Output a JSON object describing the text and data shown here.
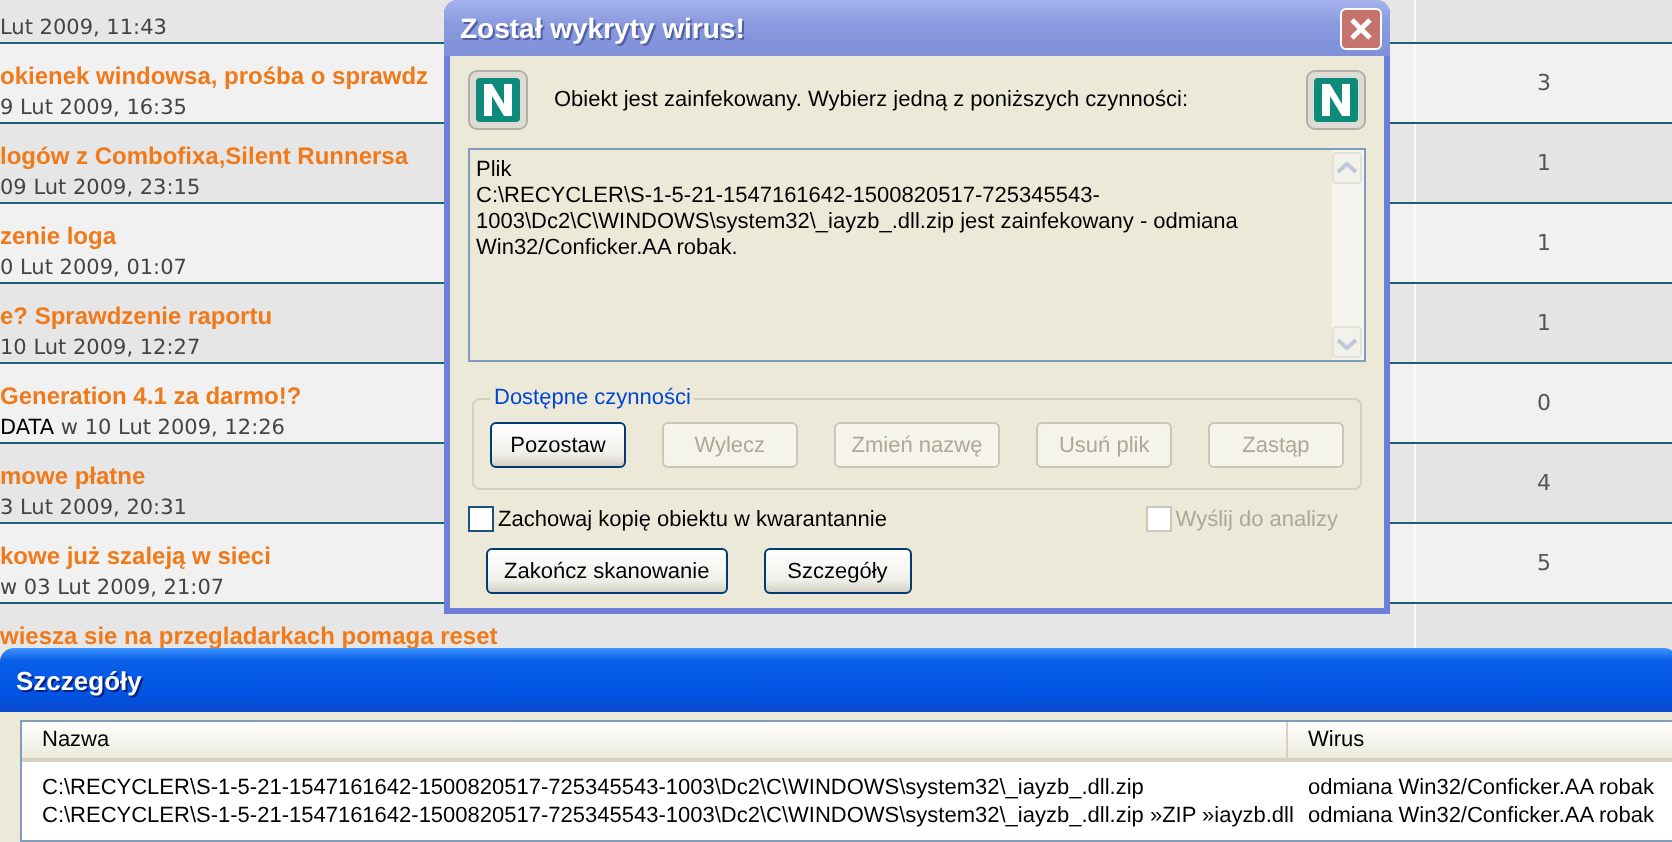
{
  "forum": {
    "topics": [
      {
        "date": "Lut 2009, 11:43"
      },
      {
        "title": "okienek windowsa, prośba o sprawdz",
        "date": "9 Lut 2009, 16:35",
        "replies": "3"
      },
      {
        "title": "logów z Combofixa,Silent Runnersa",
        "date": "09 Lut 2009, 23:15",
        "replies": "1"
      },
      {
        "title": "zenie loga",
        "date": "0 Lut 2009, 01:07",
        "replies": "1"
      },
      {
        "title": "e? Sprawdzenie raportu",
        "date": "10 Lut 2009, 12:27",
        "replies": "1"
      },
      {
        "title": "Generation 4.1 za darmo!?",
        "author": "DATA",
        "date": "w 10 Lut 2009, 12:26",
        "replies": "0"
      },
      {
        "title": "mowe płatne",
        "date": "3 Lut 2009, 20:31",
        "replies": "4"
      },
      {
        "title": "kowe już szaleją w sieci",
        "date": "w 03 Lut 2009, 21:07",
        "replies": "5"
      },
      {
        "title": "wiesza sie na przegladarkach pomaga reset"
      }
    ]
  },
  "dialog": {
    "title": "Został wykryty wirus!",
    "message": "Obiekt jest zainfekowany. Wybierz jedną z poniższych czynności:",
    "details": [
      "Plik",
      "C:\\RECYCLER\\S-1-5-21-1547161642-1500820517-725345543-1003\\Dc2\\C\\WINDOWS\\system32\\_iayzb_.dll.zip jest zainfekowany - odmiana Win32/Conficker.AA robak."
    ],
    "actions": {
      "label": "Dostępne czynności",
      "buttons": [
        {
          "label": "Pozostaw",
          "disabled": false
        },
        {
          "label": "Wylecz",
          "disabled": true
        },
        {
          "label": "Zmień nazwę",
          "disabled": true
        },
        {
          "label": "Usuń plik",
          "disabled": true
        },
        {
          "label": "Zastąp",
          "disabled": true
        }
      ]
    },
    "options": [
      {
        "label": "Zachowaj kopię obiektu w kwarantannie",
        "checked": false,
        "disabled": false
      },
      {
        "label": "Wyślij do analizy",
        "checked": false,
        "disabled": true
      }
    ],
    "buttons": [
      {
        "label": "Zakończ skanowanie"
      },
      {
        "label": "Szczegóły"
      }
    ]
  },
  "details_window": {
    "title": "Szczegóły",
    "columns": [
      "Nazwa",
      "Wirus"
    ],
    "rows": [
      [
        "C:\\RECYCLER\\S-1-5-21-1547161642-1500820517-725345543-1003\\Dc2\\C\\WINDOWS\\system32\\_iayzb_.dll.zip",
        "odmiana Win32/Conficker.AA robak"
      ],
      [
        "C:\\RECYCLER\\S-1-5-21-1547161642-1500820517-725345543-1003\\Dc2\\C\\WINDOWS\\system32\\_iayzb_.dll.zip »ZIP »iayzb.dll",
        "odmiana Win32/Conficker.AA robak"
      ]
    ]
  }
}
